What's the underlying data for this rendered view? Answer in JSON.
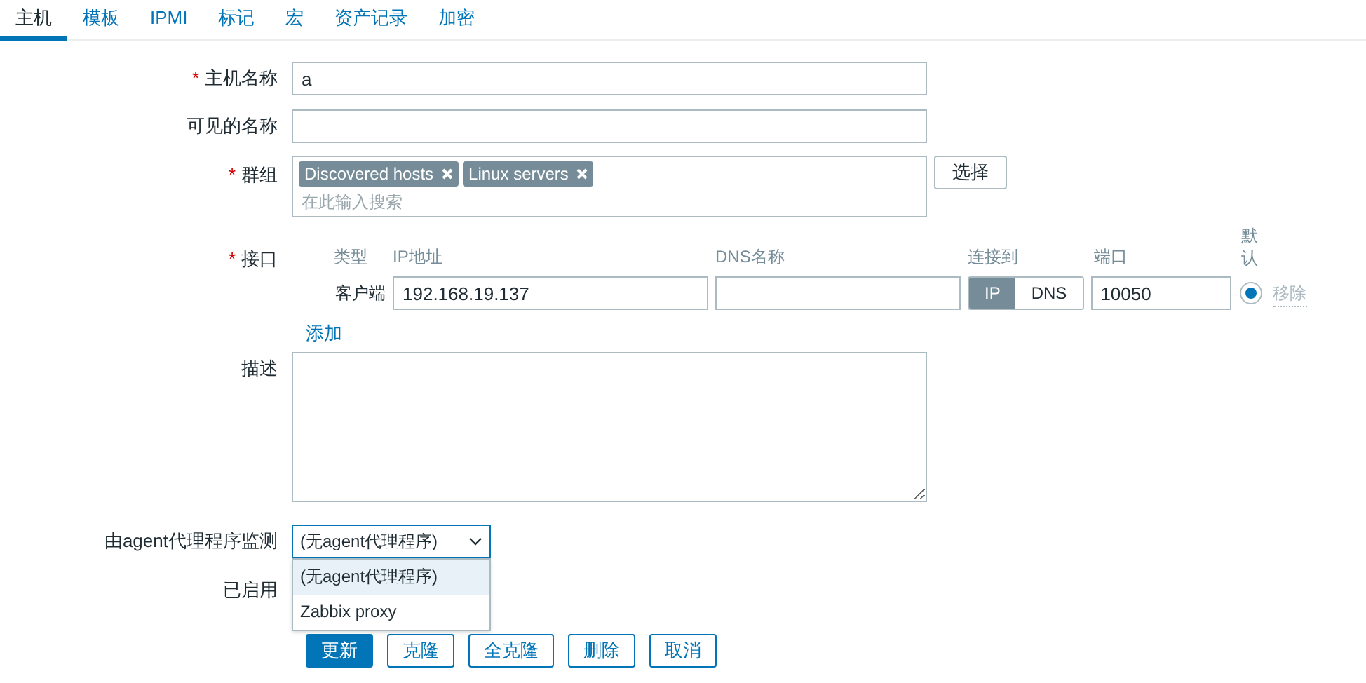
{
  "tabs": [
    {
      "label": "主机",
      "selected": true
    },
    {
      "label": "模板",
      "selected": false
    },
    {
      "label": "IPMI",
      "selected": false
    },
    {
      "label": "标记",
      "selected": false
    },
    {
      "label": "宏",
      "selected": false
    },
    {
      "label": "资产记录",
      "selected": false
    },
    {
      "label": "加密",
      "selected": false
    }
  ],
  "host_name": {
    "label": "主机名称",
    "required_mark": "*",
    "value": "a"
  },
  "visible_name": {
    "label": "可见的名称"
  },
  "groups": {
    "label": "群组",
    "required_mark": "*",
    "tags": [
      "Discovered hosts",
      "Linux servers"
    ],
    "placeholder": "在此输入搜索",
    "select_button": "选择"
  },
  "interfaces": {
    "label": "接口",
    "required_mark": "*",
    "columns": [
      "类型",
      "IP地址",
      "DNS名称",
      "连接到",
      "端口"
    ],
    "default_header": [
      "默",
      "认"
    ],
    "rows": [
      {
        "type": "客户端",
        "ip": "192.168.19.137",
        "connect": [
          {
            "label": "IP",
            "selected": true
          },
          {
            "label": "DNS",
            "selected": false
          }
        ],
        "port": "10050",
        "default": true,
        "remove": "移除"
      }
    ],
    "add": "添加"
  },
  "description": {
    "label": "描述"
  },
  "monitored_by": {
    "label": "由agent代理程序监测",
    "value": "(无agent代理程序)",
    "options": [
      {
        "label": "(无agent代理程序)",
        "selected": true
      },
      {
        "label": "Zabbix proxy",
        "selected": false
      }
    ]
  },
  "enabled": {
    "label": "已启用"
  },
  "buttons": [
    {
      "label": "更新",
      "kind": "primary"
    },
    {
      "label": "克隆",
      "kind": "secondary"
    },
    {
      "label": "全克隆",
      "kind": "secondary"
    },
    {
      "label": "删除",
      "kind": "secondary"
    },
    {
      "label": "取消",
      "kind": "secondary"
    }
  ]
}
